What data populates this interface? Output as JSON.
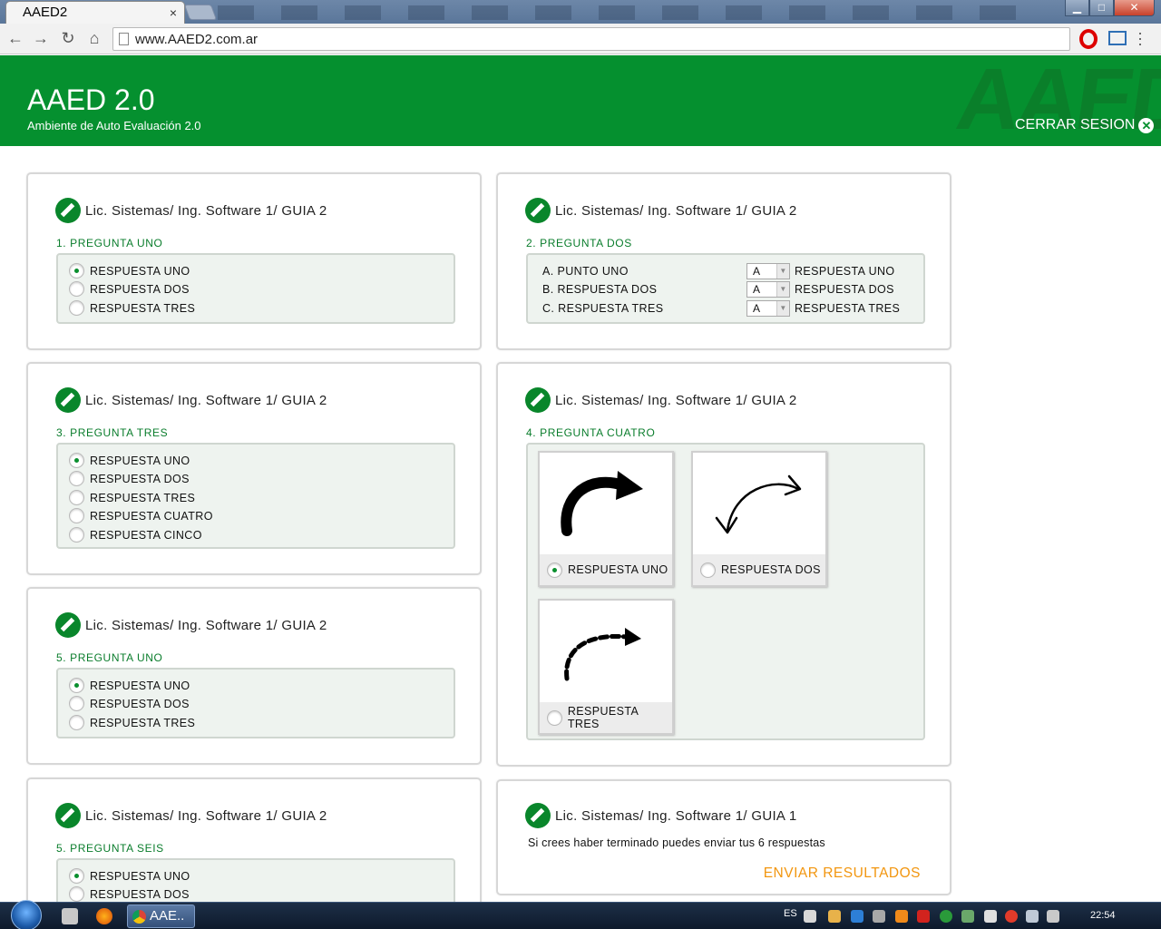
{
  "browser": {
    "tab_title": "AAED2",
    "tab_close": "×",
    "url": "www.AAED2.com.ar",
    "nav": {
      "back": "←",
      "forward": "→",
      "reload": "↻",
      "home": "⌂"
    },
    "window_buttons": {
      "minimize": "▁",
      "maximize": "□",
      "close": "✕"
    },
    "icons": [
      "page-icon",
      "opera-icon",
      "cast-icon",
      "menu-icon"
    ]
  },
  "app": {
    "title": "AAED 2.0",
    "subtitle": "Ambiente de Auto Evaluación 2.0",
    "watermark": "AAED",
    "logout_label": "CERRAR SESION",
    "logout_icon": "✕",
    "brand_color": "#05902f",
    "accent_color": "#f2960f"
  },
  "cards": [
    {
      "title": "Lic. Sistemas/ Ing. Software 1/ GUIA 2",
      "question": "1. PREGUNTA UNO",
      "type": "radio",
      "options": [
        "RESPUESTA UNO",
        "RESPUESTA DOS",
        "RESPUESTA TRES"
      ],
      "selected": 0
    },
    {
      "title": "Lic. Sistemas/ Ing. Software 1/ GUIA 2",
      "question": "2. PREGUNTA DOS",
      "type": "match",
      "rows": [
        {
          "left": "A. PUNTO UNO",
          "value": "A",
          "right": "RESPUESTA UNO"
        },
        {
          "left": "B. RESPUESTA DOS",
          "value": "A",
          "right": "RESPUESTA DOS"
        },
        {
          "left": "C. RESPUESTA TRES",
          "value": "A",
          "right": "RESPUESTA TRES"
        }
      ]
    },
    {
      "title": "Lic. Sistemas/ Ing. Software 1/ GUIA 2",
      "question": "3. PREGUNTA TRES",
      "type": "radio",
      "options": [
        "RESPUESTA UNO",
        "RESPUESTA DOS",
        "RESPUESTA TRES",
        "RESPUESTA CUATRO",
        "RESPUESTA CINCO"
      ],
      "selected": 0
    },
    {
      "title": "Lic. Sistemas/ Ing. Software 1/ GUIA 2",
      "question": "4. PREGUNTA CUATRO",
      "type": "image",
      "options": [
        {
          "label": "RESPUESTA UNO",
          "image": "thick-curved-arrow-icon"
        },
        {
          "label": "RESPUESTA DOS",
          "image": "thin-curved-arrow-icon"
        },
        {
          "label": "RESPUESTA TRES",
          "image": "dashed-curved-arrow-icon"
        }
      ],
      "selected": 0
    },
    {
      "title": "Lic. Sistemas/ Ing. Software 1/ GUIA 2",
      "question": "5. PREGUNTA UNO",
      "type": "radio",
      "options": [
        "RESPUESTA UNO",
        "RESPUESTA DOS",
        "RESPUESTA TRES"
      ],
      "selected": 0
    },
    {
      "title": "Lic. Sistemas/ Ing. Software 1/ GUIA 2",
      "question": "5. PREGUNTA SEIS",
      "type": "radio",
      "options": [
        "RESPUESTA UNO",
        "RESPUESTA DOS"
      ],
      "selected": 0
    },
    {
      "title": "Lic. Sistemas/ Ing. Software 1/ GUIA 1",
      "type": "submit",
      "note": "Si crees haber terminado puedes enviar tus 6 respuestas",
      "button": "ENVIAR RESULTADOS"
    }
  ],
  "taskbar": {
    "task_label": "AAE..",
    "language": "ES",
    "time": "22:54"
  }
}
